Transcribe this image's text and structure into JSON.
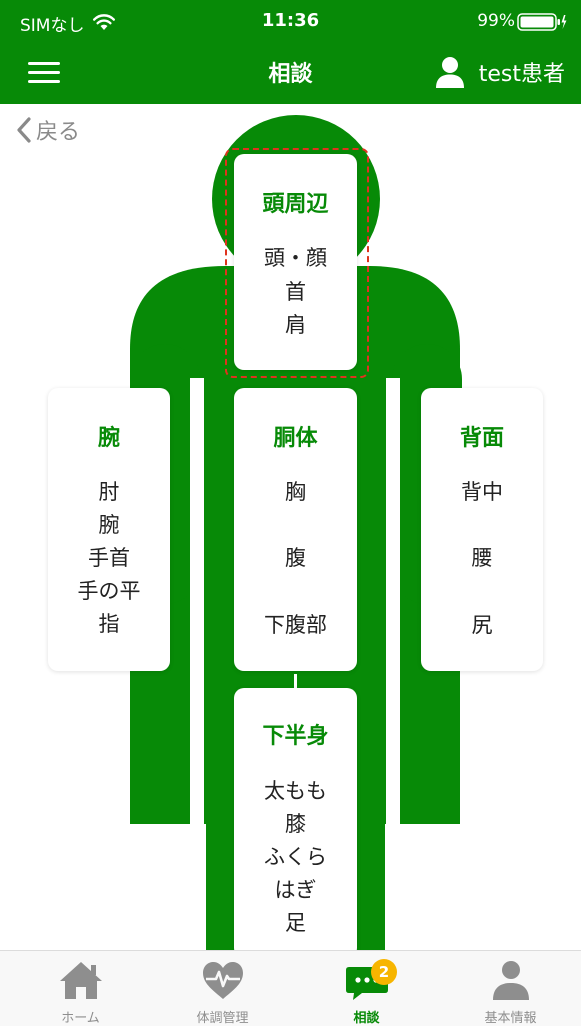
{
  "status_bar": {
    "carrier": "SIMなし",
    "time": "11:36",
    "battery": "99%"
  },
  "nav": {
    "title": "相談",
    "user_name": "test患者"
  },
  "back": {
    "label": "戻る"
  },
  "regions": {
    "head": {
      "title": "頭周辺",
      "items": [
        "頭・顔",
        "首",
        "肩"
      ]
    },
    "arm": {
      "title": "腕",
      "items": [
        "肘",
        "腕",
        "手首",
        "手の平",
        "指"
      ]
    },
    "torso": {
      "title": "胴体",
      "items": [
        "胸",
        "腹",
        "下腹部"
      ]
    },
    "back": {
      "title": "背面",
      "items": [
        "背中",
        "腰",
        "尻"
      ]
    },
    "lower": {
      "title": "下半身",
      "items": [
        "太もも",
        "膝",
        "ふくら",
        "はぎ",
        "足"
      ]
    }
  },
  "tabbar": {
    "tabs": [
      {
        "label": "ホーム",
        "icon": "home-icon"
      },
      {
        "label": "体調管理",
        "icon": "heart-pulse-icon"
      },
      {
        "label": "相談",
        "icon": "chat-bubble-icon",
        "badge": "2"
      },
      {
        "label": "基本情報",
        "icon": "person-icon"
      }
    ]
  },
  "colors": {
    "brand_green": "#078a07",
    "selection_outline": "#e0321e",
    "badge": "#f7b500",
    "tab_inactive": "#8e8e8e"
  }
}
